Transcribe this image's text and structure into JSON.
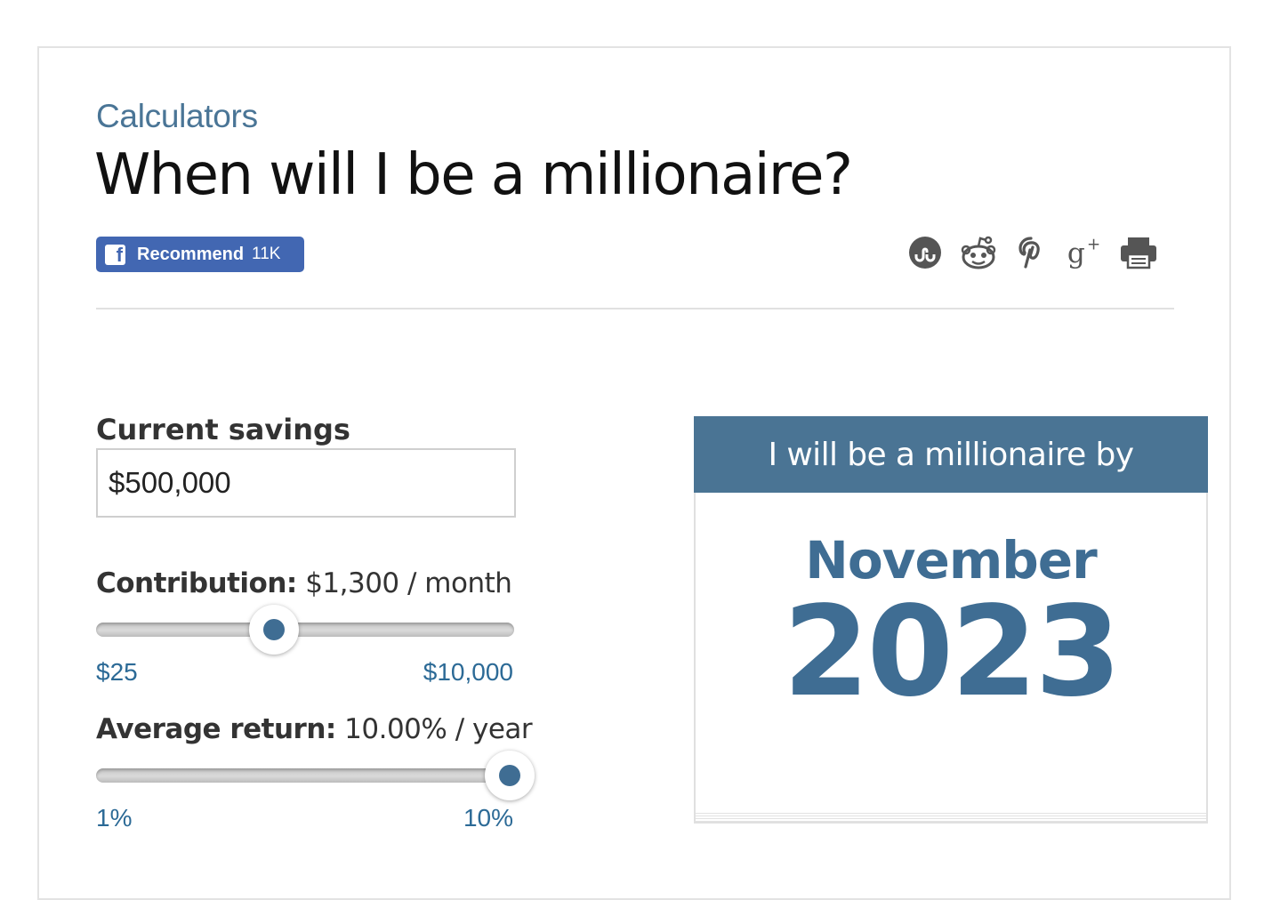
{
  "header": {
    "kicker": "Calculators",
    "title": "When will I be a millionaire?"
  },
  "social": {
    "facebook": {
      "logo_letter": "f",
      "label": "Recommend",
      "count": "11K"
    },
    "share_icons": [
      "stumbleupon-icon",
      "reddit-icon",
      "pinterest-icon",
      "google-plus-icon",
      "print-icon"
    ]
  },
  "form": {
    "savings": {
      "label": "Current savings",
      "value": "$500,000"
    },
    "contribution": {
      "label": "Contribution:",
      "value_text": "$1,300 / month",
      "min_label": "$25",
      "max_label": "$10,000",
      "value": 1300,
      "min": 25,
      "max": 10000
    },
    "return": {
      "label": "Average return:",
      "value_text": "10.00% / year",
      "min_label": "1%",
      "max_label": "10%",
      "value": 10,
      "min": 1,
      "max": 10
    }
  },
  "result": {
    "header": "I will be a millionaire by",
    "month": "November",
    "year": "2023"
  },
  "colors": {
    "accent": "#4a7494",
    "link": "#2c6a96",
    "facebook": "#4267b2"
  }
}
